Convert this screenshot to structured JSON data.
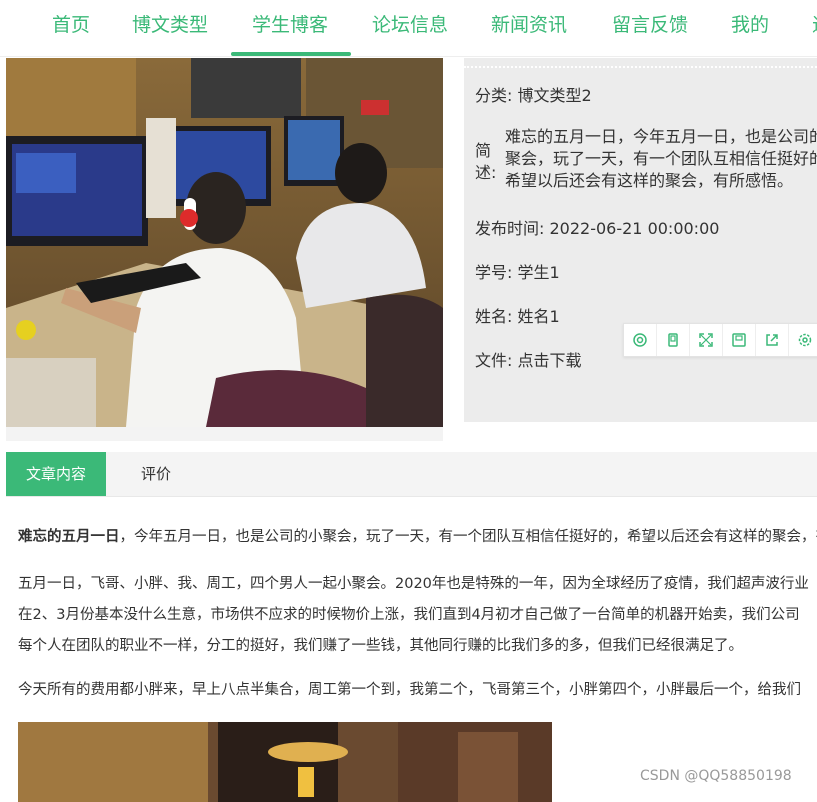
{
  "nav": {
    "items": [
      {
        "label": "首页"
      },
      {
        "label": "博文类型"
      },
      {
        "label": "学生博客",
        "active": true
      },
      {
        "label": "论坛信息"
      },
      {
        "label": "新闻资讯"
      },
      {
        "label": "留言反馈"
      },
      {
        "label": "我的"
      },
      {
        "label": "退"
      }
    ],
    "accent_color": "#3bb978"
  },
  "info": {
    "category_label": "分类:",
    "category_value": "博文类型2",
    "desc_label": "简述:",
    "desc_text": "难忘的五月一日，今年五月一日，也是公司的小聚会，玩了一天，有一个团队互相信任挺好的，希望以后还会有这样的聚会，有所感悟。",
    "publish_label": "发布时间:",
    "publish_value": "2022-06-21 00:00:00",
    "student_no_label": "学号:",
    "student_no_value": "学生1",
    "name_label": "姓名:",
    "name_value": "姓名1",
    "file_label": "文件:",
    "file_value": "点击下载"
  },
  "toolbar": {
    "icons": [
      "target-icon",
      "copy-icon",
      "expand-icon",
      "save-icon",
      "share-icon",
      "settings-icon"
    ]
  },
  "tabs": {
    "content": "文章内容",
    "review": "评价"
  },
  "article": {
    "p1_bold": "难忘的五月一日",
    "p1_rest": "，今年五月一日，也是公司的小聚会，玩了一天，有一个团队互相信任挺好的，希望以后还会有这样的聚会，有所感悟。",
    "p2_l1": "五月一日，飞哥、小胖、我、周工，四个男人一起小聚会。2020年也是特殊的一年，因为全球经历了疫情，我们超声波行业",
    "p2_l2": "在2、3月份基本没什么生意，市场供不应求的时候物价上涨，我们直到4月初才自己做了一台简单的机器开始卖，我们公司",
    "p2_l3": "每个人在团队的职业不一样，分工的挺好，我们赚了一些钱，其他同行赚的比我们多的多，但我们已经很满足了。",
    "p3": "今天所有的费用都小胖来，早上八点半集合，周工第一个到，我第二个，飞哥第三个，小胖第四个，小胖最后一个，给我们"
  },
  "watermark": "CSDN @QQ58850198"
}
